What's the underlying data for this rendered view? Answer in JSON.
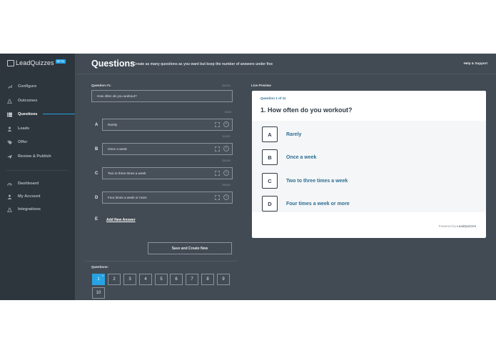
{
  "app": {
    "logo_text": "LeadQuizzes",
    "logo_badge": "BETA"
  },
  "sidebar": {
    "items": [
      {
        "label": "Configure",
        "icon": "wrench-icon"
      },
      {
        "label": "Outcomes",
        "icon": "flask-icon"
      },
      {
        "label": "Questions",
        "icon": "list-icon",
        "active": true
      },
      {
        "label": "Leads",
        "icon": "users-icon"
      },
      {
        "label": "Offer",
        "icon": "tag-icon"
      },
      {
        "label": "Review & Publish",
        "icon": "send-icon"
      }
    ],
    "bottom_items": [
      {
        "label": "Dashboard",
        "icon": "dashboard-icon"
      },
      {
        "label": "My Account",
        "icon": "user-icon"
      },
      {
        "label": "Integrations",
        "icon": "flask-icon"
      }
    ]
  },
  "header": {
    "title": "Questions",
    "subtitle": "/  Create as many questions as you want but keep the number of answers under five",
    "help_link": "Help & Support"
  },
  "editor": {
    "question_label": "Question #1:",
    "question_counter": "25/100",
    "question_value": "How often do you workout?",
    "answers": [
      {
        "letter": "A",
        "text": "Rarely",
        "counter": "6/100"
      },
      {
        "letter": "B",
        "text": "Once a week",
        "counter": "11/100"
      },
      {
        "letter": "C",
        "text": "Two to three times a week",
        "counter": "25/100"
      },
      {
        "letter": "D",
        "text": "Four times a week or more",
        "counter": "25/100"
      }
    ],
    "add_letter": "E",
    "add_answer_label": "Add New Answer",
    "save_button": "Save and Create New",
    "questions_label": "Questions:",
    "question_numbers": [
      "1",
      "2",
      "3",
      "4",
      "5",
      "6",
      "7",
      "8",
      "9",
      "10"
    ],
    "active_question": "1"
  },
  "preview": {
    "label": "Live Preview",
    "count": "Question 1 of 11",
    "question": "1. How often do you workout?",
    "answers": [
      {
        "letter": "A",
        "text": "Rarely"
      },
      {
        "letter": "B",
        "text": "Once a week"
      },
      {
        "letter": "C",
        "text": "Two to three times a week"
      },
      {
        "letter": "D",
        "text": "Four times a week or more"
      }
    ],
    "powered_prefix": "Powered by",
    "powered_brand": "LeadQuizzes"
  },
  "colors": {
    "accent": "#27a3e3",
    "sidebar_bg": "#2d353d",
    "main_bg": "#424b54",
    "preview_text": "#2e6d93"
  }
}
